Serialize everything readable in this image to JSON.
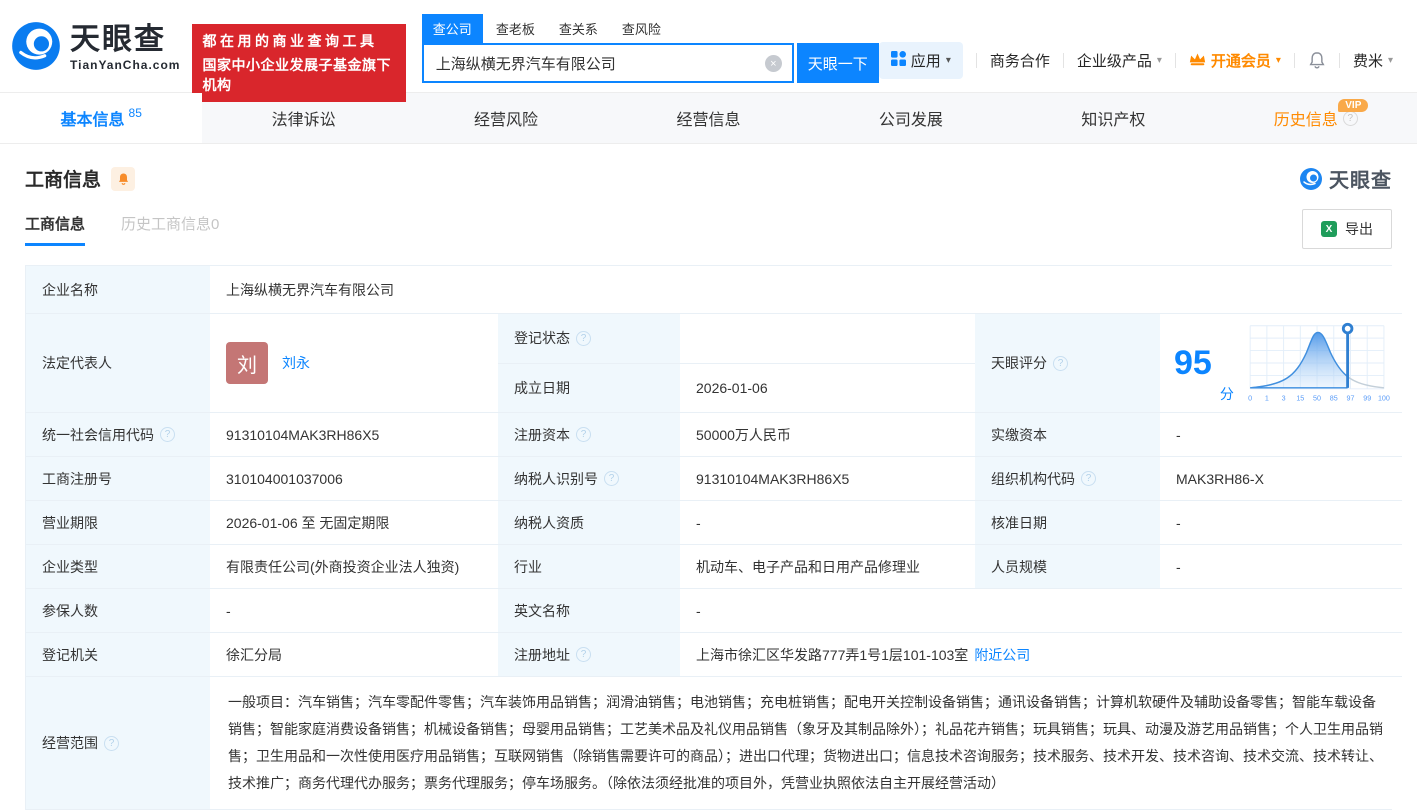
{
  "header": {
    "logo": {
      "brand": "天眼查",
      "domain": "TianYanCha.com"
    },
    "banner": {
      "line1": "都在用的商业查询工具",
      "line2": "国家中小企业发展子基金旗下机构"
    },
    "search": {
      "tabs": [
        {
          "label": "查公司",
          "active": true
        },
        {
          "label": "查老板",
          "active": false
        },
        {
          "label": "查关系",
          "active": false
        },
        {
          "label": "查风险",
          "active": false
        }
      ],
      "value": "上海纵横无界汽车有限公司",
      "clear_icon": "×",
      "button": "天眼一下"
    },
    "nav": {
      "apps": "应用",
      "cooperation": "商务合作",
      "enterprise": "企业级产品",
      "vip": "开通会员",
      "user": "费米"
    }
  },
  "tabs": [
    {
      "label": "基本信息",
      "count": "85",
      "active": true
    },
    {
      "label": "法律诉讼"
    },
    {
      "label": "经营风险"
    },
    {
      "label": "经营信息"
    },
    {
      "label": "公司发展"
    },
    {
      "label": "知识产权"
    },
    {
      "label": "历史信息",
      "badge": "VIP"
    }
  ],
  "section": {
    "title": "工商信息",
    "watermark": "天眼查",
    "subtabs": [
      {
        "label": "工商信息",
        "active": true
      },
      {
        "label": "历史工商信息0",
        "active": false
      }
    ],
    "export_label": "导出"
  },
  "table": {
    "company_name_label": "企业名称",
    "company_name": "上海纵横无界汽车有限公司",
    "legal_rep_label": "法定代表人",
    "legal_rep_avatar": "刘",
    "legal_rep_name": "刘永",
    "reg_status_label": "登记状态",
    "reg_status": "",
    "establish_date_label": "成立日期",
    "establish_date": "2026-01-06",
    "score_label": "天眼评分",
    "score": "95",
    "score_unit": "分",
    "score_ticks": [
      "0",
      "1",
      "3",
      "15",
      "50",
      "85",
      "97",
      "99",
      "100"
    ],
    "credit_code_label": "统一社会信用代码",
    "credit_code": "91310104MAK3RH86X5",
    "reg_capital_label": "注册资本",
    "reg_capital": "50000万人民币",
    "paid_capital_label": "实缴资本",
    "paid_capital": "-",
    "reg_number_label": "工商注册号",
    "reg_number": "310104001037006",
    "taxpayer_id_label": "纳税人识别号",
    "taxpayer_id": "91310104MAK3RH86X5",
    "org_code_label": "组织机构代码",
    "org_code": "MAK3RH86-X",
    "business_term_label": "营业期限",
    "business_term": "2026-01-06 至 无固定期限",
    "taxpayer_quality_label": "纳税人资质",
    "taxpayer_quality": "-",
    "approval_date_label": "核准日期",
    "approval_date": "-",
    "company_type_label": "企业类型",
    "company_type": "有限责任公司(外商投资企业法人独资)",
    "industry_label": "行业",
    "industry": "机动车、电子产品和日用产品修理业",
    "staff_size_label": "人员规模",
    "staff_size": "-",
    "insured_label": "参保人数",
    "insured": "-",
    "english_name_label": "英文名称",
    "english_name": "-",
    "reg_authority_label": "登记机关",
    "reg_authority": "徐汇分局",
    "reg_address_label": "注册地址",
    "reg_address": "上海市徐汇区华发路777弄1号1层101-103室",
    "nearby_link": "附近公司",
    "business_scope_label": "经营范围",
    "business_scope": "一般项目：汽车销售；汽车零配件零售；汽车装饰用品销售；润滑油销售；电池销售；充电桩销售；配电开关控制设备销售；通讯设备销售；计算机软硬件及辅助设备零售；智能车载设备销售；智能家庭消费设备销售；机械设备销售；母婴用品销售；工艺美术品及礼仪用品销售（象牙及其制品除外）；礼品花卉销售；玩具销售；玩具、动漫及游艺用品销售；个人卫生用品销售；卫生用品和一次性使用医疗用品销售；互联网销售（除销售需要许可的商品）；进出口代理；货物进出口；信息技术咨询服务；技术服务、技术开发、技术咨询、技术交流、技术转让、技术推广；商务代理代办服务；票务代理服务；停车场服务。（除依法须经批准的项目外，凭营业执照依法自主开展经营活动）"
  }
}
